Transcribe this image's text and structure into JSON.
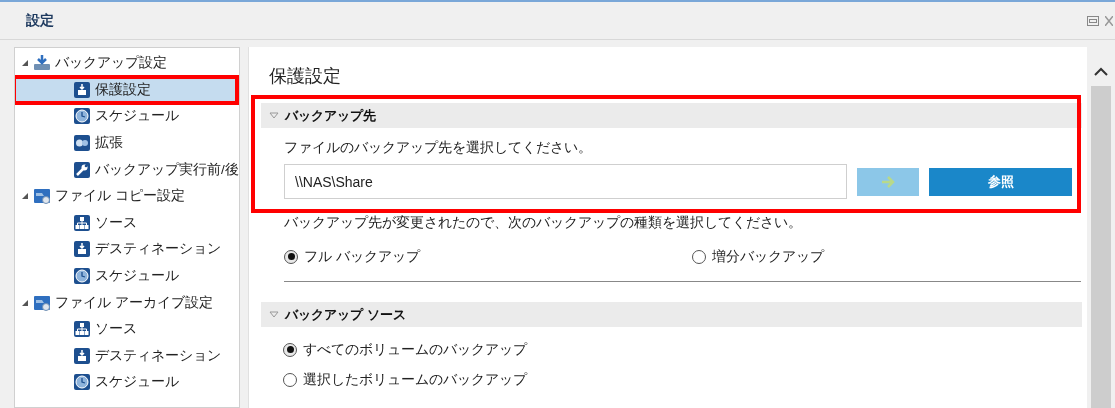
{
  "window": {
    "title": "設定"
  },
  "tree": [
    {
      "label": "バックアップ設定",
      "kind": "backup",
      "expanded": true,
      "selected": false,
      "children": [
        {
          "label": "保護設定",
          "kind": "destination",
          "selected": true
        },
        {
          "label": "スケジュール",
          "kind": "clock",
          "selected": false
        },
        {
          "label": "拡張",
          "kind": "gears",
          "selected": false
        },
        {
          "label": "バックアップ実行前/後",
          "kind": "wrench",
          "selected": false
        }
      ]
    },
    {
      "label": "ファイル コピー設定",
      "kind": "copy",
      "expanded": true,
      "selected": false,
      "children": [
        {
          "label": "ソース",
          "kind": "network",
          "selected": false
        },
        {
          "label": "デスティネーション",
          "kind": "destination",
          "selected": false
        },
        {
          "label": "スケジュール",
          "kind": "clock",
          "selected": false
        }
      ]
    },
    {
      "label": "ファイル アーカイブ設定",
      "kind": "copy",
      "expanded": true,
      "selected": false,
      "children": [
        {
          "label": "ソース",
          "kind": "network",
          "selected": false
        },
        {
          "label": "デスティネーション",
          "kind": "destination",
          "selected": false
        },
        {
          "label": "スケジュール",
          "kind": "clock",
          "selected": false
        }
      ]
    }
  ],
  "content": {
    "heading": "保護設定",
    "destination": {
      "title": "バックアップ先",
      "expanded": true,
      "prompt": "ファイルのバックアップ先を選択してください。",
      "path": "\\\\NAS\\Share",
      "go_disabled": true,
      "browse_label": "参照",
      "notice": "バックアップ先が変更されたので、次のバックアップの種類を選択してください。",
      "options": [
        {
          "label": "フル バックアップ",
          "selected": true
        },
        {
          "label": "増分バックアップ",
          "selected": false
        }
      ]
    },
    "source": {
      "title": "バックアップ ソース",
      "expanded": true,
      "options": [
        {
          "label": "すべてのボリュームのバックアップ",
          "selected": true
        },
        {
          "label": "選択したボリュームのバックアップ",
          "selected": false
        }
      ]
    }
  }
}
